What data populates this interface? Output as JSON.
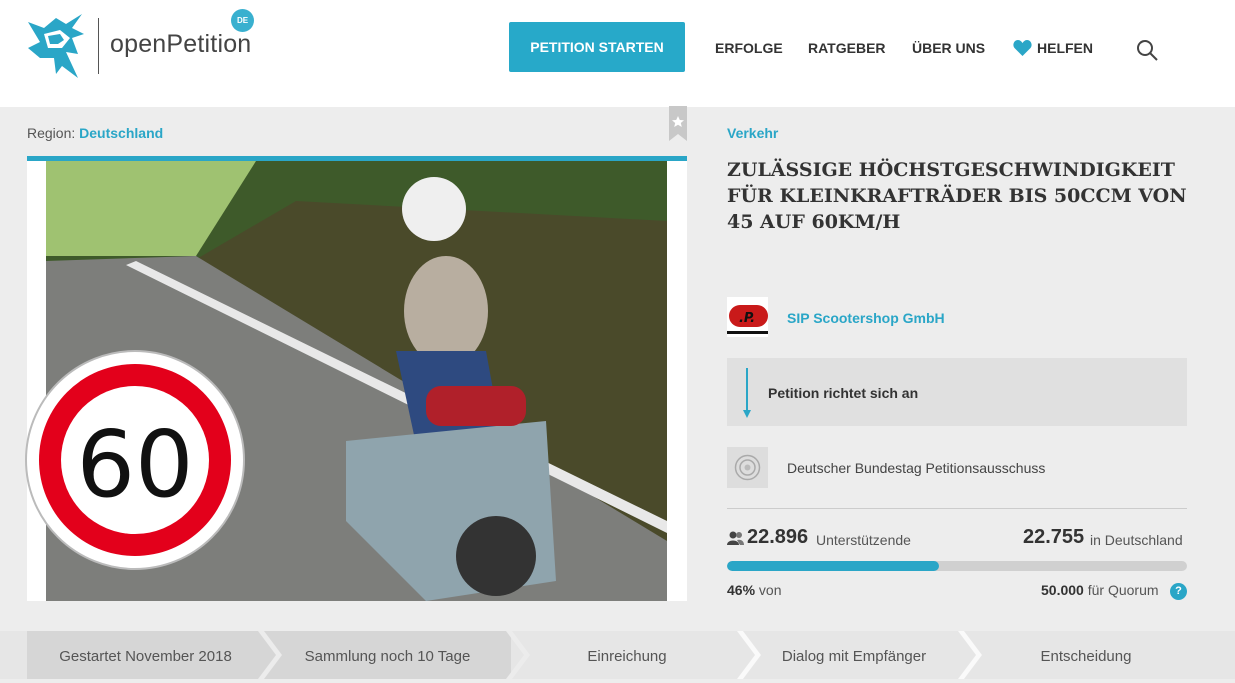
{
  "brand": {
    "name": "openPetition",
    "country_badge": "DE"
  },
  "nav": {
    "start_label": "PETITION STARTEN",
    "items": [
      "ERFOLGE",
      "RATGEBER",
      "ÜBER UNS",
      "HELFEN"
    ]
  },
  "region": {
    "label": "Region:",
    "value": "Deutschland"
  },
  "petition": {
    "category": "Verkehr",
    "title": "ZULÄSSIGE HÖCHSTGESCHWINDIGKEIT FÜR KLEINKRAFTRÄDER BIS 50CCM VON 45 AUF 60KM/H",
    "sign_value": "60",
    "author": "SIP Scootershop GmbH",
    "addressee_label": "Petition richtet sich an",
    "recipient": "Deutscher Bundestag Petitionsausschuss"
  },
  "stats": {
    "supporters": "22.896",
    "supporters_label": "Unterstützende",
    "germany": "22.755",
    "germany_label": "in Deutschland",
    "progress_fraction": 0.46,
    "percent": "46%",
    "percent_suffix": "von",
    "quorum": "50.000",
    "quorum_label": "für Quorum",
    "help_icon_text": "?"
  },
  "steps": [
    "Gestartet November 2018",
    "Sammlung noch 10 Tage",
    "Einreichung",
    "Dialog mit Empfänger",
    "Entscheidung"
  ],
  "colors": {
    "accent": "#27a9c9",
    "step_active": "#d6d6d6",
    "step_inactive": "#e8e8e8"
  }
}
